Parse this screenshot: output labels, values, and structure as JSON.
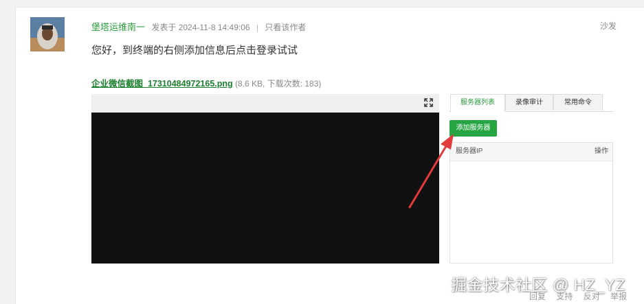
{
  "post": {
    "author": "堡塔运维南一",
    "posted_at": "发表于 2024-11-8 14:49:06",
    "separator": "|",
    "only_author": "只看该作者",
    "floor": "沙发",
    "content": "您好，到终端的右侧添加信息后点击登录试试"
  },
  "attachment": {
    "filename": "企业微信截图_17310484972165.png",
    "info": "(8.6 KB, 下载次数: 183)"
  },
  "screenshot": {
    "tabs": [
      {
        "label": "服务器列表"
      },
      {
        "label": "录像审计"
      },
      {
        "label": "常用命令"
      }
    ],
    "add_button": "添加服务器",
    "table_headers": {
      "ip": "服务器IP",
      "action": "操作"
    }
  },
  "footer": {
    "reply": "回复",
    "support": "支持",
    "oppose": "反对",
    "report": "举报"
  },
  "watermark": "掘金技术社区 @ HZ_YZ",
  "colors": {
    "author_green": "#2a9d3c",
    "button_green": "#26a543",
    "arrow_red": "#e23b3b",
    "terminal_bg": "#111111"
  }
}
